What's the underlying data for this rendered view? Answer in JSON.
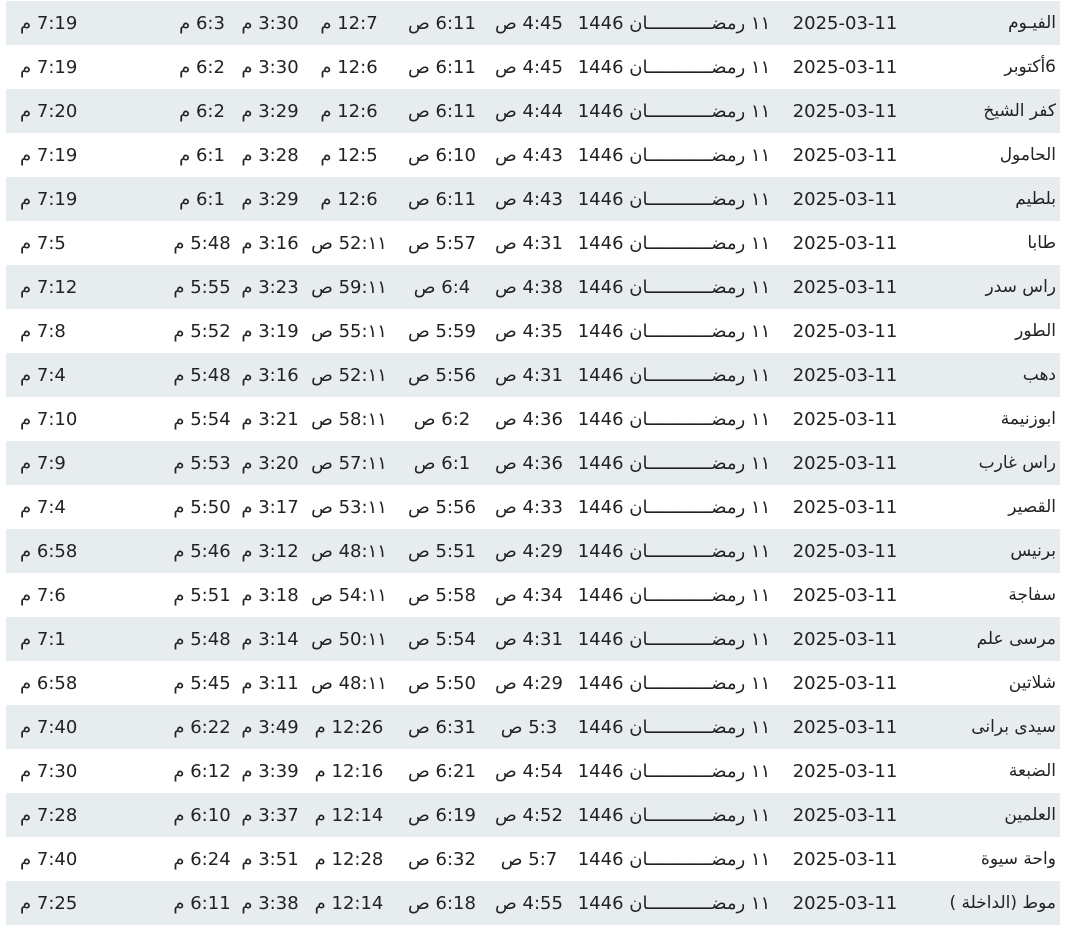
{
  "table": {
    "rows": [
      {
        "city": "الفيـوم",
        "gregorian": "2025-03-11",
        "hijri": "١١ رمضــــــــــــان 1446",
        "imsak": "4:45 ص",
        "fajr": "6:11 ص",
        "dhuhr": "12:7 م",
        "asr": "3:30 م",
        "maghrib": "6:3 م",
        "isha": "7:19 م"
      },
      {
        "city": "6أكتوبر",
        "gregorian": "2025-03-11",
        "hijri": "١١ رمضــــــــــــان 1446",
        "imsak": "4:45 ص",
        "fajr": "6:11 ص",
        "dhuhr": "12:6 م",
        "asr": "3:30 م",
        "maghrib": "6:2 م",
        "isha": "7:19 م"
      },
      {
        "city": "كفر الشيخ",
        "gregorian": "2025-03-11",
        "hijri": "١١ رمضــــــــــــان 1446",
        "imsak": "4:44 ص",
        "fajr": "6:11 ص",
        "dhuhr": "12:6 م",
        "asr": "3:29 م",
        "maghrib": "6:2 م",
        "isha": "7:20 م"
      },
      {
        "city": "الحامول",
        "gregorian": "2025-03-11",
        "hijri": "١١ رمضــــــــــــان 1446",
        "imsak": "4:43 ص",
        "fajr": "6:10 ص",
        "dhuhr": "12:5 م",
        "asr": "3:28 م",
        "maghrib": "6:1 م",
        "isha": "7:19 م"
      },
      {
        "city": "بلطيم",
        "gregorian": "2025-03-11",
        "hijri": "١١ رمضــــــــــــان 1446",
        "imsak": "4:43 ص",
        "fajr": "6:11 ص",
        "dhuhr": "12:6 م",
        "asr": "3:29 م",
        "maghrib": "6:1 م",
        "isha": "7:19 م"
      },
      {
        "city": "طابا",
        "gregorian": "2025-03-11",
        "hijri": "١١ رمضــــــــــــان 1446",
        "imsak": "4:31 ص",
        "fajr": "5:57 ص",
        "dhuhr": "١١:52 ص",
        "asr": "3:16 م",
        "maghrib": "5:48 م",
        "isha": "7:5 م"
      },
      {
        "city": "راس سدر",
        "gregorian": "2025-03-11",
        "hijri": "١١ رمضــــــــــــان 1446",
        "imsak": "4:38 ص",
        "fajr": "6:4 ص",
        "dhuhr": "١١:59 ص",
        "asr": "3:23 م",
        "maghrib": "5:55 م",
        "isha": "7:12 م"
      },
      {
        "city": "الطور",
        "gregorian": "2025-03-11",
        "hijri": "١١ رمضــــــــــــان 1446",
        "imsak": "4:35 ص",
        "fajr": "5:59 ص",
        "dhuhr": "١١:55 ص",
        "asr": "3:19 م",
        "maghrib": "5:52 م",
        "isha": "7:8 م"
      },
      {
        "city": "دهب",
        "gregorian": "2025-03-11",
        "hijri": "١١ رمضــــــــــــان 1446",
        "imsak": "4:31 ص",
        "fajr": "5:56 ص",
        "dhuhr": "١١:52 ص",
        "asr": "3:16 م",
        "maghrib": "5:48 م",
        "isha": "7:4 م"
      },
      {
        "city": "ابوزنيمة",
        "gregorian": "2025-03-11",
        "hijri": "١١ رمضــــــــــــان 1446",
        "imsak": "4:36 ص",
        "fajr": "6:2 ص",
        "dhuhr": "١١:58 ص",
        "asr": "3:21 م",
        "maghrib": "5:54 م",
        "isha": "7:10 م"
      },
      {
        "city": "راس غارب",
        "gregorian": "2025-03-11",
        "hijri": "١١ رمضــــــــــــان 1446",
        "imsak": "4:36 ص",
        "fajr": "6:1 ص",
        "dhuhr": "١١:57 ص",
        "asr": "3:20 م",
        "maghrib": "5:53 م",
        "isha": "7:9 م"
      },
      {
        "city": "القصير",
        "gregorian": "2025-03-11",
        "hijri": "١١ رمضــــــــــــان 1446",
        "imsak": "4:33 ص",
        "fajr": "5:56 ص",
        "dhuhr": "١١:53 ص",
        "asr": "3:17 م",
        "maghrib": "5:50 م",
        "isha": "7:4 م"
      },
      {
        "city": "برنيس",
        "gregorian": "2025-03-11",
        "hijri": "١١ رمضــــــــــــان 1446",
        "imsak": "4:29 ص",
        "fajr": "5:51 ص",
        "dhuhr": "١١:48 ص",
        "asr": "3:12 م",
        "maghrib": "5:46 م",
        "isha": "6:58 م"
      },
      {
        "city": "سفاجة",
        "gregorian": "2025-03-11",
        "hijri": "١١ رمضــــــــــــان 1446",
        "imsak": "4:34 ص",
        "fajr": "5:58 ص",
        "dhuhr": "١١:54 ص",
        "asr": "3:18 م",
        "maghrib": "5:51 م",
        "isha": "7:6 م"
      },
      {
        "city": "مرسى علم",
        "gregorian": "2025-03-11",
        "hijri": "١١ رمضــــــــــــان 1446",
        "imsak": "4:31 ص",
        "fajr": "5:54 ص",
        "dhuhr": "١١:50 ص",
        "asr": "3:14 م",
        "maghrib": "5:48 م",
        "isha": "7:1 م"
      },
      {
        "city": "شلاتين",
        "gregorian": "2025-03-11",
        "hijri": "١١ رمضــــــــــــان 1446",
        "imsak": "4:29 ص",
        "fajr": "5:50 ص",
        "dhuhr": "١١:48 ص",
        "asr": "3:11 م",
        "maghrib": "5:45 م",
        "isha": "6:58 م"
      },
      {
        "city": "سيدى برانى",
        "gregorian": "2025-03-11",
        "hijri": "١١ رمضــــــــــــان 1446",
        "imsak": "5:3 ص",
        "fajr": "6:31 ص",
        "dhuhr": "12:26 م",
        "asr": "3:49 م",
        "maghrib": "6:22 م",
        "isha": "7:40 م"
      },
      {
        "city": "الضبعة",
        "gregorian": "2025-03-11",
        "hijri": "١١ رمضــــــــــــان 1446",
        "imsak": "4:54 ص",
        "fajr": "6:21 ص",
        "dhuhr": "12:16 م",
        "asr": "3:39 م",
        "maghrib": "6:12 م",
        "isha": "7:30 م"
      },
      {
        "city": "العلمين",
        "gregorian": "2025-03-11",
        "hijri": "١١ رمضــــــــــــان 1446",
        "imsak": "4:52 ص",
        "fajr": "6:19 ص",
        "dhuhr": "12:14 م",
        "asr": "3:37 م",
        "maghrib": "6:10 م",
        "isha": "7:28 م"
      },
      {
        "city": "واحة سيوة",
        "gregorian": "2025-03-11",
        "hijri": "١١ رمضــــــــــــان 1446",
        "imsak": "5:7 ص",
        "fajr": "6:32 ص",
        "dhuhr": "12:28 م",
        "asr": "3:51 م",
        "maghrib": "6:24 م",
        "isha": "7:40 م"
      },
      {
        "city": "موط (الداخلة )",
        "gregorian": "2025-03-11",
        "hijri": "١١ رمضــــــــــــان 1446",
        "imsak": "4:55 ص",
        "fajr": "6:18 ص",
        "dhuhr": "12:14 م",
        "asr": "3:38 م",
        "maghrib": "6:11 م",
        "isha": "7:25 م"
      }
    ]
  }
}
